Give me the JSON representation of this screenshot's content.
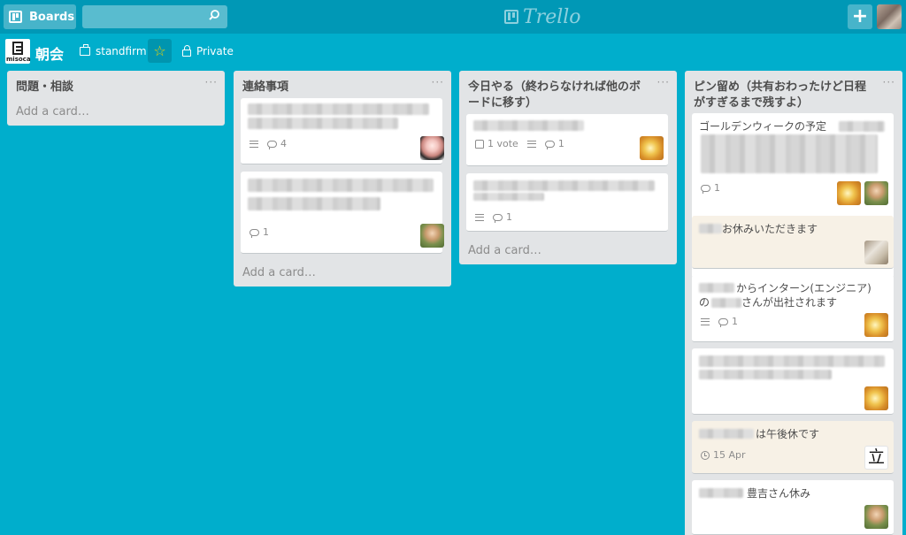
{
  "header": {
    "boards_label": "Boards",
    "search_placeholder": "",
    "logo_text": "Trello",
    "add_label": "+"
  },
  "board": {
    "logo_label": "misoca",
    "title": "朝会",
    "team": "standfirm",
    "star": "☆",
    "privacy": "Private"
  },
  "lists": [
    {
      "name": "問題・相談",
      "menu": "···",
      "add_card": "Add a card…",
      "cards": []
    },
    {
      "name": "連絡事項",
      "menu": "···",
      "add_card": "Add a card…",
      "cards": [
        {
          "comments": "4"
        },
        {
          "comments": "1"
        }
      ]
    },
    {
      "name": "今日やる（終わらなければ他のボードに移す）",
      "name_line1": "今日やる（終わらなければ他のボ",
      "name_line2": "ードに移す）",
      "menu": "···",
      "add_card": "Add a card…",
      "cards": [
        {
          "votes": "1 vote",
          "comments": "1"
        },
        {
          "comments": "1"
        }
      ]
    },
    {
      "name": "ピン留め（共有おわったけど日程がすぎるまで残すよ）",
      "name_line1": "ピン留め（共有おわったけど日程",
      "name_line2": "がすぎるまで残すよ）",
      "menu": "···",
      "cards": [
        {
          "title": "ゴールデンウィークの予定",
          "comments": "1"
        },
        {
          "title": "お休みいただきます"
        },
        {
          "title_line1": "からインターン(エンジニア)",
          "title_line2_prefix": "の",
          "title_line2": "さんが出社されます",
          "comments": "1"
        },
        {},
        {
          "title": "は午後休です",
          "due": "15 Apr",
          "avatar_text": "立"
        },
        {
          "title": "豊吉さん休み"
        }
      ]
    }
  ],
  "colors": {
    "board_background": "#00aecc",
    "header_background": "#0098b6",
    "list_background": "#e2e4e6",
    "star": "#f2d600"
  }
}
